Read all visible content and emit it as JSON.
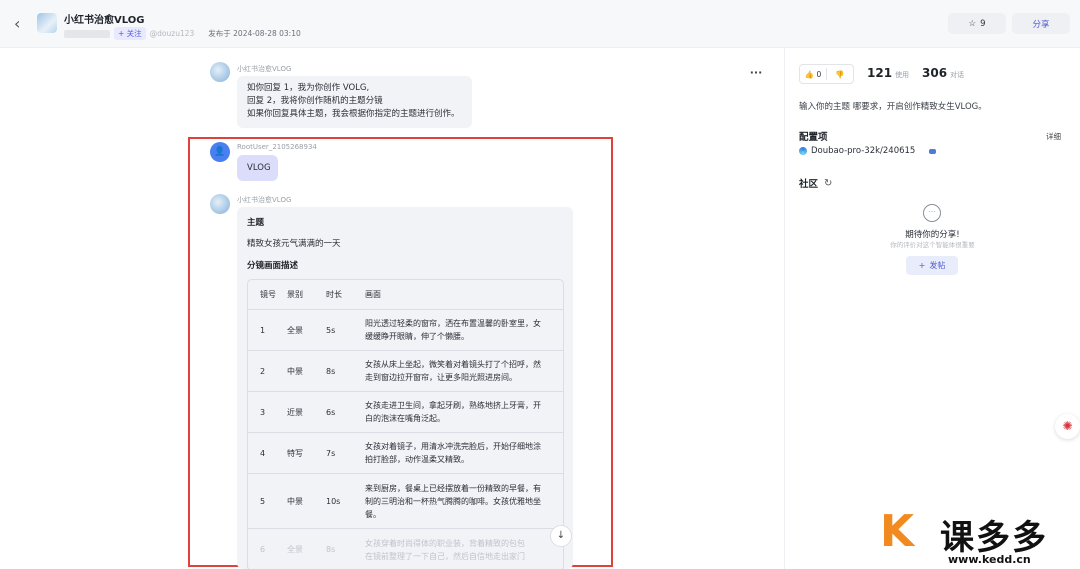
{
  "header": {
    "title": "小红书治愈VLOG",
    "follow_label": "+ 关注",
    "handle": "@douzu123",
    "published": "发布于 2024-08-28 03:10",
    "star_count": "9",
    "share_label": "分享"
  },
  "messages": {
    "bot_name": "小红书治愈VLOG",
    "intro_lines": [
      "如你回复 1，我为你创作 VOLG,",
      "回复 2，我将你创作随机的主题分镜",
      "如果你回复具体主题，我会根据你指定的主题进行创作。"
    ],
    "user_name": "RootUser_2105268934",
    "user_text": "VLOG",
    "reply": {
      "theme_heading": "主题",
      "theme_text": "精致女孩元气满满的一天",
      "storyboard_heading": "分镜画面描述",
      "table_headers": [
        "镜号",
        "景别",
        "时长",
        "画面"
      ],
      "rows": [
        {
          "no": "1",
          "shot": "全景",
          "dur": "5s",
          "lines": [
            "阳光透过轻柔的窗帘，洒在布置温馨的卧室里，女",
            "缓缓睁开眼睛，伸了个懒腰。"
          ]
        },
        {
          "no": "2",
          "shot": "中景",
          "dur": "8s",
          "lines": [
            "女孩从床上坐起，微笑着对着镜头打了个招呼，然",
            "走到窗边拉开窗帘，让更多阳光照进房间。"
          ]
        },
        {
          "no": "3",
          "shot": "近景",
          "dur": "6s",
          "lines": [
            "女孩走进卫生间，拿起牙刷，熟练地挤上牙膏，开",
            "白的泡沫在嘴角泛起。"
          ]
        },
        {
          "no": "4",
          "shot": "特写",
          "dur": "7s",
          "lines": [
            "女孩对着镜子，用清水冲洗完脸后，开始仔细地涂",
            "拍打脸部，动作温柔又精致。"
          ]
        },
        {
          "no": "5",
          "shot": "中景",
          "dur": "10s",
          "lines": [
            "来到厨房，餐桌上已经摆放着一份精致的早餐，有",
            "制的三明治和一杯热气腾腾的咖啡。女孩优雅地坐",
            "餐。"
          ]
        },
        {
          "no": "6",
          "shot": "全景",
          "dur": "8s",
          "lines": [
            "女孩穿着时尚得体的职业装，背着精致的包包",
            "在镜前整理了一下自己，然后自信地走出家门"
          ]
        }
      ]
    }
  },
  "sidebar": {
    "likes": "0",
    "uses_count": "121",
    "uses_label": "使用",
    "conversations_count": "306",
    "conversations_label": "对话",
    "description": "输入你的主题 哪要求，开启创作精致女生VLOG。",
    "config_title": "配置项",
    "detail_label": "详细",
    "model": "Doubao-pro-32k/240615",
    "community_title": "社区",
    "empty_title": "期待你的分享!",
    "empty_sub": "你的评价对这个智能体很重要",
    "post_label": "发帖"
  },
  "watermark": {
    "brand_cn": "课多多",
    "url": "www.kedd.cn"
  }
}
